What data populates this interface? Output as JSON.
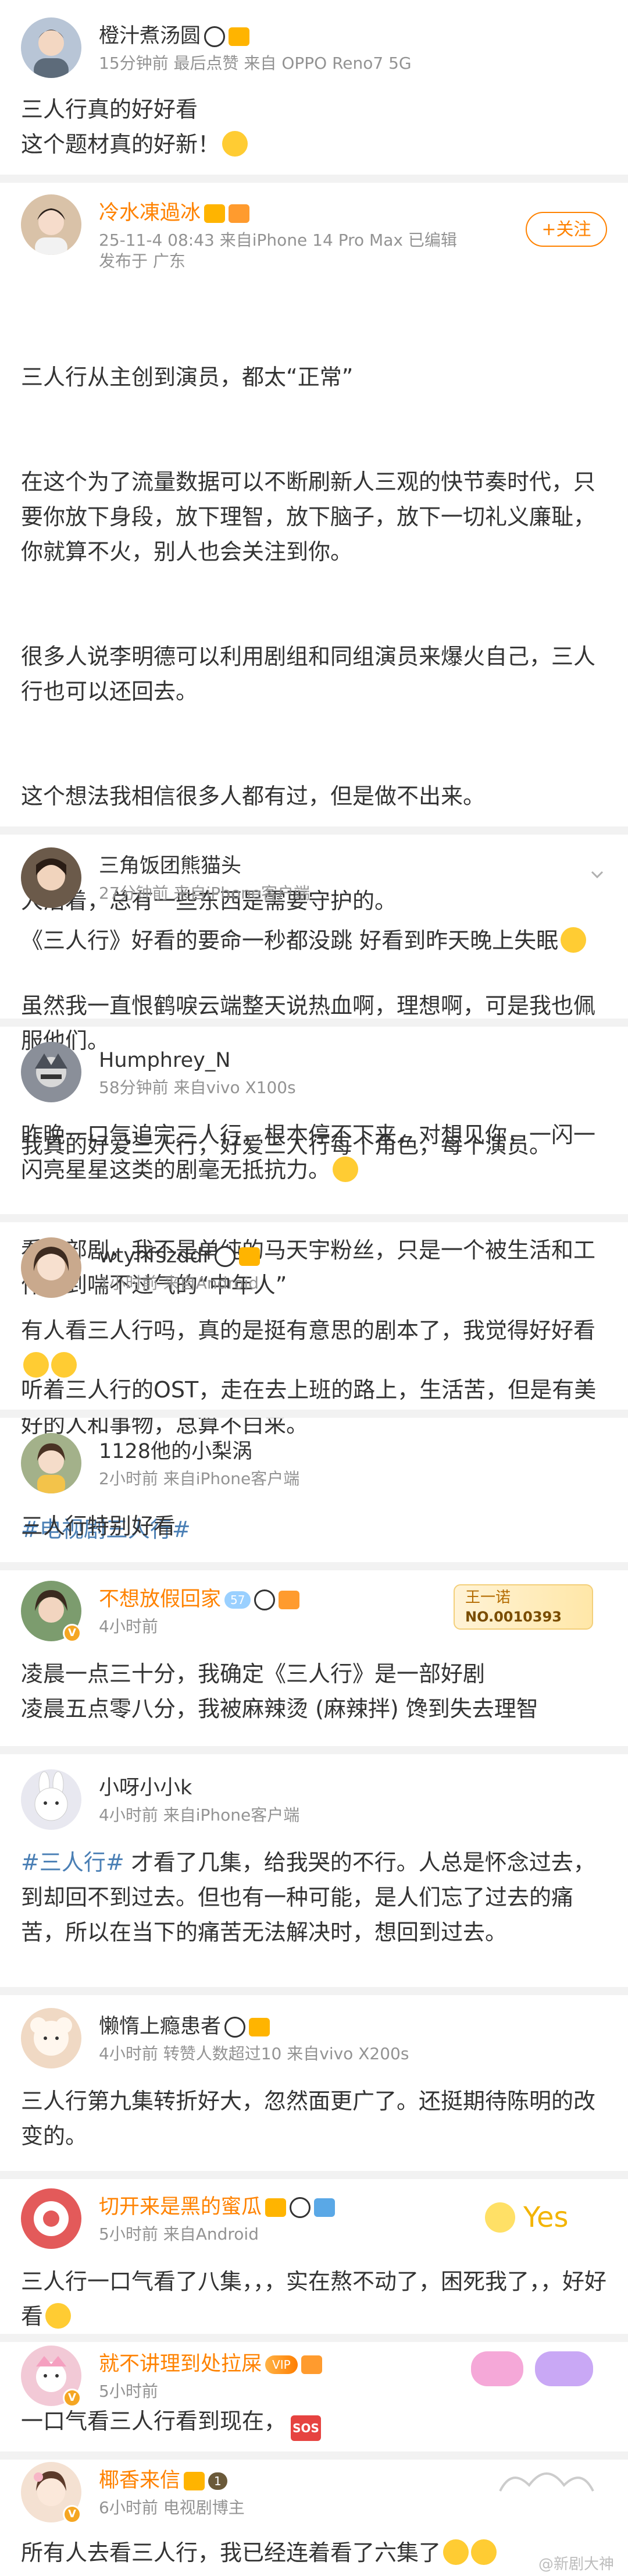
{
  "posts": [
    {
      "username": "橙汁煮汤圆",
      "meta": "15分钟前  最后点赞  来自 OPPO Reno7 5G",
      "content": "三人行真的好好看\n这个题材真的好新！",
      "avatar_color": "#b8c5d6"
    },
    {
      "username": "冷水凍過冰",
      "meta": "25-11-4 08:43  来自iPhone 14 Pro Max  已编辑",
      "meta2": "发布于 广东",
      "follow_label": "+关注",
      "content_lines": [
        "三人行从主创到演员，都太“正常”",
        "在这个为了流量数据可以不断刷新人三观的快节奏时代，只要你放下身段，放下理智，放下脑子，放下一切礼义廉耻，你就算不火，别人也会关注到你。",
        "很多人说李明德可以利用剧组和同组演员来爆火自己，三人行也可以还回去。",
        "这个想法我相信很多人都有过，但是做不出来。",
        "人活着，总有一些东西是需要守护的。",
        "虽然我一直恨鹤唳云端整天说热血啊，理想啊，可是我也佩服他们。",
        "我真的好爱三人行，好爱三人行每个角色，每个演员。",
        "看这部剧，我不是单纯的马天宇粉丝，只是一个被生活和工作压到喘不过气的“中年人”",
        "听着三人行的OST，走在去上班的路上，生活苦，但是有美好的人和事物，总算不白来。"
      ],
      "hashtag": "#电视剧三人行#",
      "avatar_color": "#d9c2a8"
    },
    {
      "username": "三角饭团熊猫头",
      "meta": "27分钟前  来自iPhone客户端",
      "content": "《三人行》好看的要命一秒都没跳 好看到昨天晚上失眠",
      "avatar_color": "#6b5a4a"
    },
    {
      "username": "Humphrey_N",
      "meta": "58分钟前  来自vivo X100s",
      "content": "昨晚一口气追完三人行，根本停不下来，对想见你，一闪一闪亮星星这类的剧毫无抵抗力。",
      "avatar_color": "#8a8f99"
    },
    {
      "username": "wtyhfszddr",
      "meta": "1小时前  来自Android",
      "content": "有人看三人行吗，真的是挺有意思的剧本了，我觉得好好看",
      "avatar_color": "#c9a98d"
    },
    {
      "username": "1128他的小梨涡",
      "meta": "2小时前  来自iPhone客户端",
      "content": "三人行特别好看",
      "avatar_color": "#a3b18a"
    },
    {
      "username": "不想放假回家",
      "meta": "4小时前",
      "medal_line1": "王一诺",
      "medal_line2": "NO.0010393",
      "level": "57",
      "content": "凌晨一点三十分，我确定《三人行》是一部好剧\n凌晨五点零八分，我被麻辣烫 (麻辣拌) 馋到失去理智",
      "avatar_color": "#7c9c6e"
    },
    {
      "username": "小呀小小k",
      "meta": "4小时前  来自iPhone客户端",
      "hashtag": "#三人行#",
      "content": " 才看了几集，给我哭的不行。人总是怀念过去，到却回不到过去。但也有一种可能，是人们忘了过去的痛苦，所以在当下的痛苦无法解决时，想回到过去。",
      "avatar_color": "#e8e8f0"
    },
    {
      "username": "懒惰上瘾患者",
      "meta": "4小时前  转赞人数超过10  来自vivo X200s",
      "content": "三人行第九集转折好大，忽然面更广了。还挺期待陈明的改变的。",
      "avatar_color": "#f0d9c4"
    },
    {
      "username": "切开来是黑的蜜瓜",
      "meta": "5小时前  来自Android",
      "content": "三人行一口气看了八集，，，实在熬不动了，困死我了，，好好看",
      "deco_text": "Yes",
      "avatar_color": "#e35a5a"
    },
    {
      "username": "就不讲理到处拉屎",
      "meta": "5小时前",
      "content": "一口气看三人行看到现在，",
      "sos_label": "SOS",
      "avatar_color": "#f2c9d6"
    },
    {
      "username": "椰香来信",
      "meta": "6小时前  电视剧博主",
      "level_badge": "1",
      "content": "所有人去看三人行，我已经连着看了六集了",
      "watermark": "@新剧大神",
      "avatar_color": "#f4e1d2"
    }
  ]
}
